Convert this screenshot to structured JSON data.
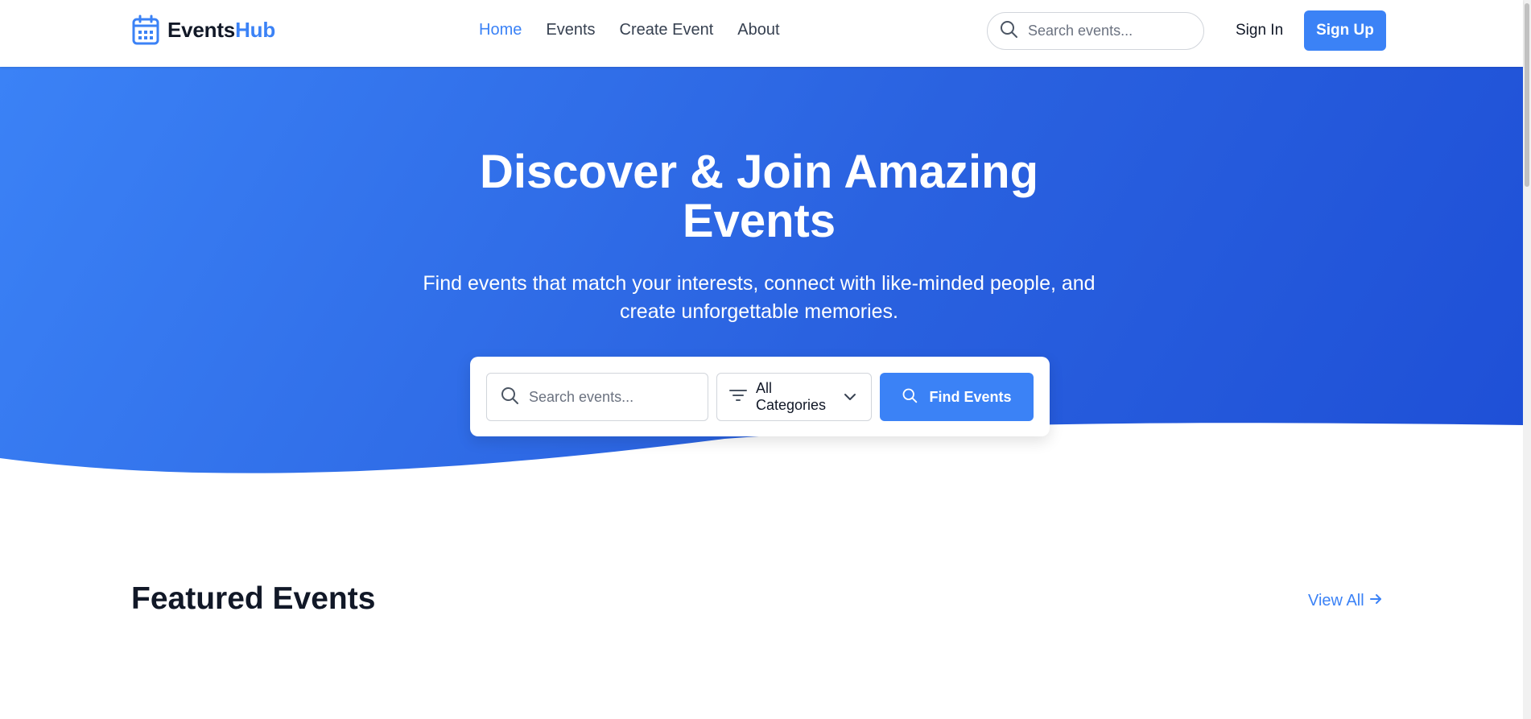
{
  "brand": {
    "name_part1": "Events",
    "name_part2": "Hub",
    "accent": "#3b82f6",
    "icon": "calendar-icon"
  },
  "nav": {
    "items": [
      {
        "label": "Home",
        "active": true
      },
      {
        "label": "Events",
        "active": false
      },
      {
        "label": "Create Event",
        "active": false
      },
      {
        "label": "About",
        "active": false
      }
    ]
  },
  "header": {
    "search_placeholder": "Search events...",
    "signin_label": "Sign In",
    "signup_label": "Sign Up"
  },
  "hero": {
    "title_line1": "Discover & Join Amazing",
    "title_line2": "Events",
    "subtitle_line1": "Find events that match your interests, connect with like-minded people, and",
    "subtitle_line2": "create unforgettable memories.",
    "gradient_start": "#3b82f6",
    "gradient_end": "#1e4fd6"
  },
  "search_panel": {
    "search_placeholder": "Search events...",
    "category_selected": "All Categories",
    "button_label": "Find Events"
  },
  "featured": {
    "title": "Featured Events",
    "view_all_label": "View All"
  }
}
